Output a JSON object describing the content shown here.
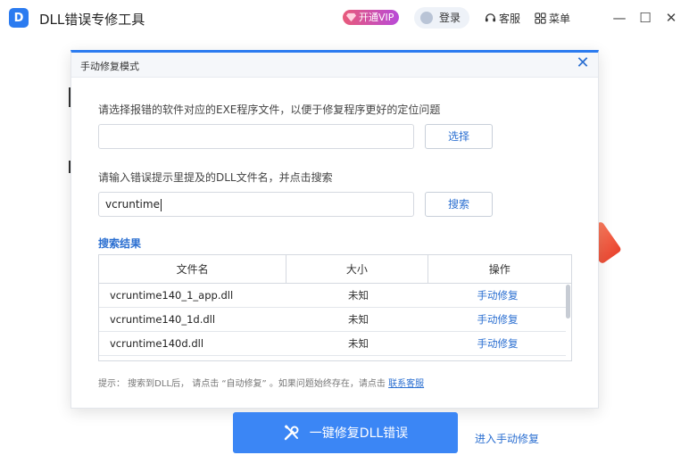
{
  "app": {
    "logo_text": "D",
    "title": "DLL错误专修工具",
    "vip_label": "开通VIP",
    "login_label": "登录",
    "service_label": "客服",
    "menu_label": "菜单",
    "minimize_glyph": "—",
    "maximize_glyph": "☐",
    "close_glyph": "✕"
  },
  "dialog": {
    "title": "手动修复模式",
    "close_glyph": "✕",
    "exe_prompt": "请选择报错的软件对应的EXE程序文件，以便于修复程序更好的定位问题",
    "exe_value": "",
    "select_label": "选择",
    "dll_prompt": "请输入错误提示里提及的DLL文件名，并点击搜索",
    "dll_value": "vcruntime",
    "search_label": "搜索",
    "results_title": "搜索结果",
    "columns": [
      "文件名",
      "大小",
      "操作"
    ],
    "rows": [
      {
        "name": "vcruntime140_1_app.dll",
        "size": "未知",
        "action": "手动修复"
      },
      {
        "name": "vcruntime140_1d.dll",
        "size": "未知",
        "action": "手动修复"
      },
      {
        "name": "vcruntime140d.dll",
        "size": "未知",
        "action": "手动修复"
      }
    ],
    "hint_text": "提示：  搜索到DLL后，  请点击 “自动修复” 。如果问题始终存在，请点击",
    "hint_link": "联系客服"
  },
  "footer": {
    "primary_label": "一键修复DLL错误",
    "manual_link": "进入手动修复"
  },
  "colors": {
    "accent": "#2b7bf0",
    "link": "#2b6fd1",
    "primary_button": "#3b86f5"
  }
}
